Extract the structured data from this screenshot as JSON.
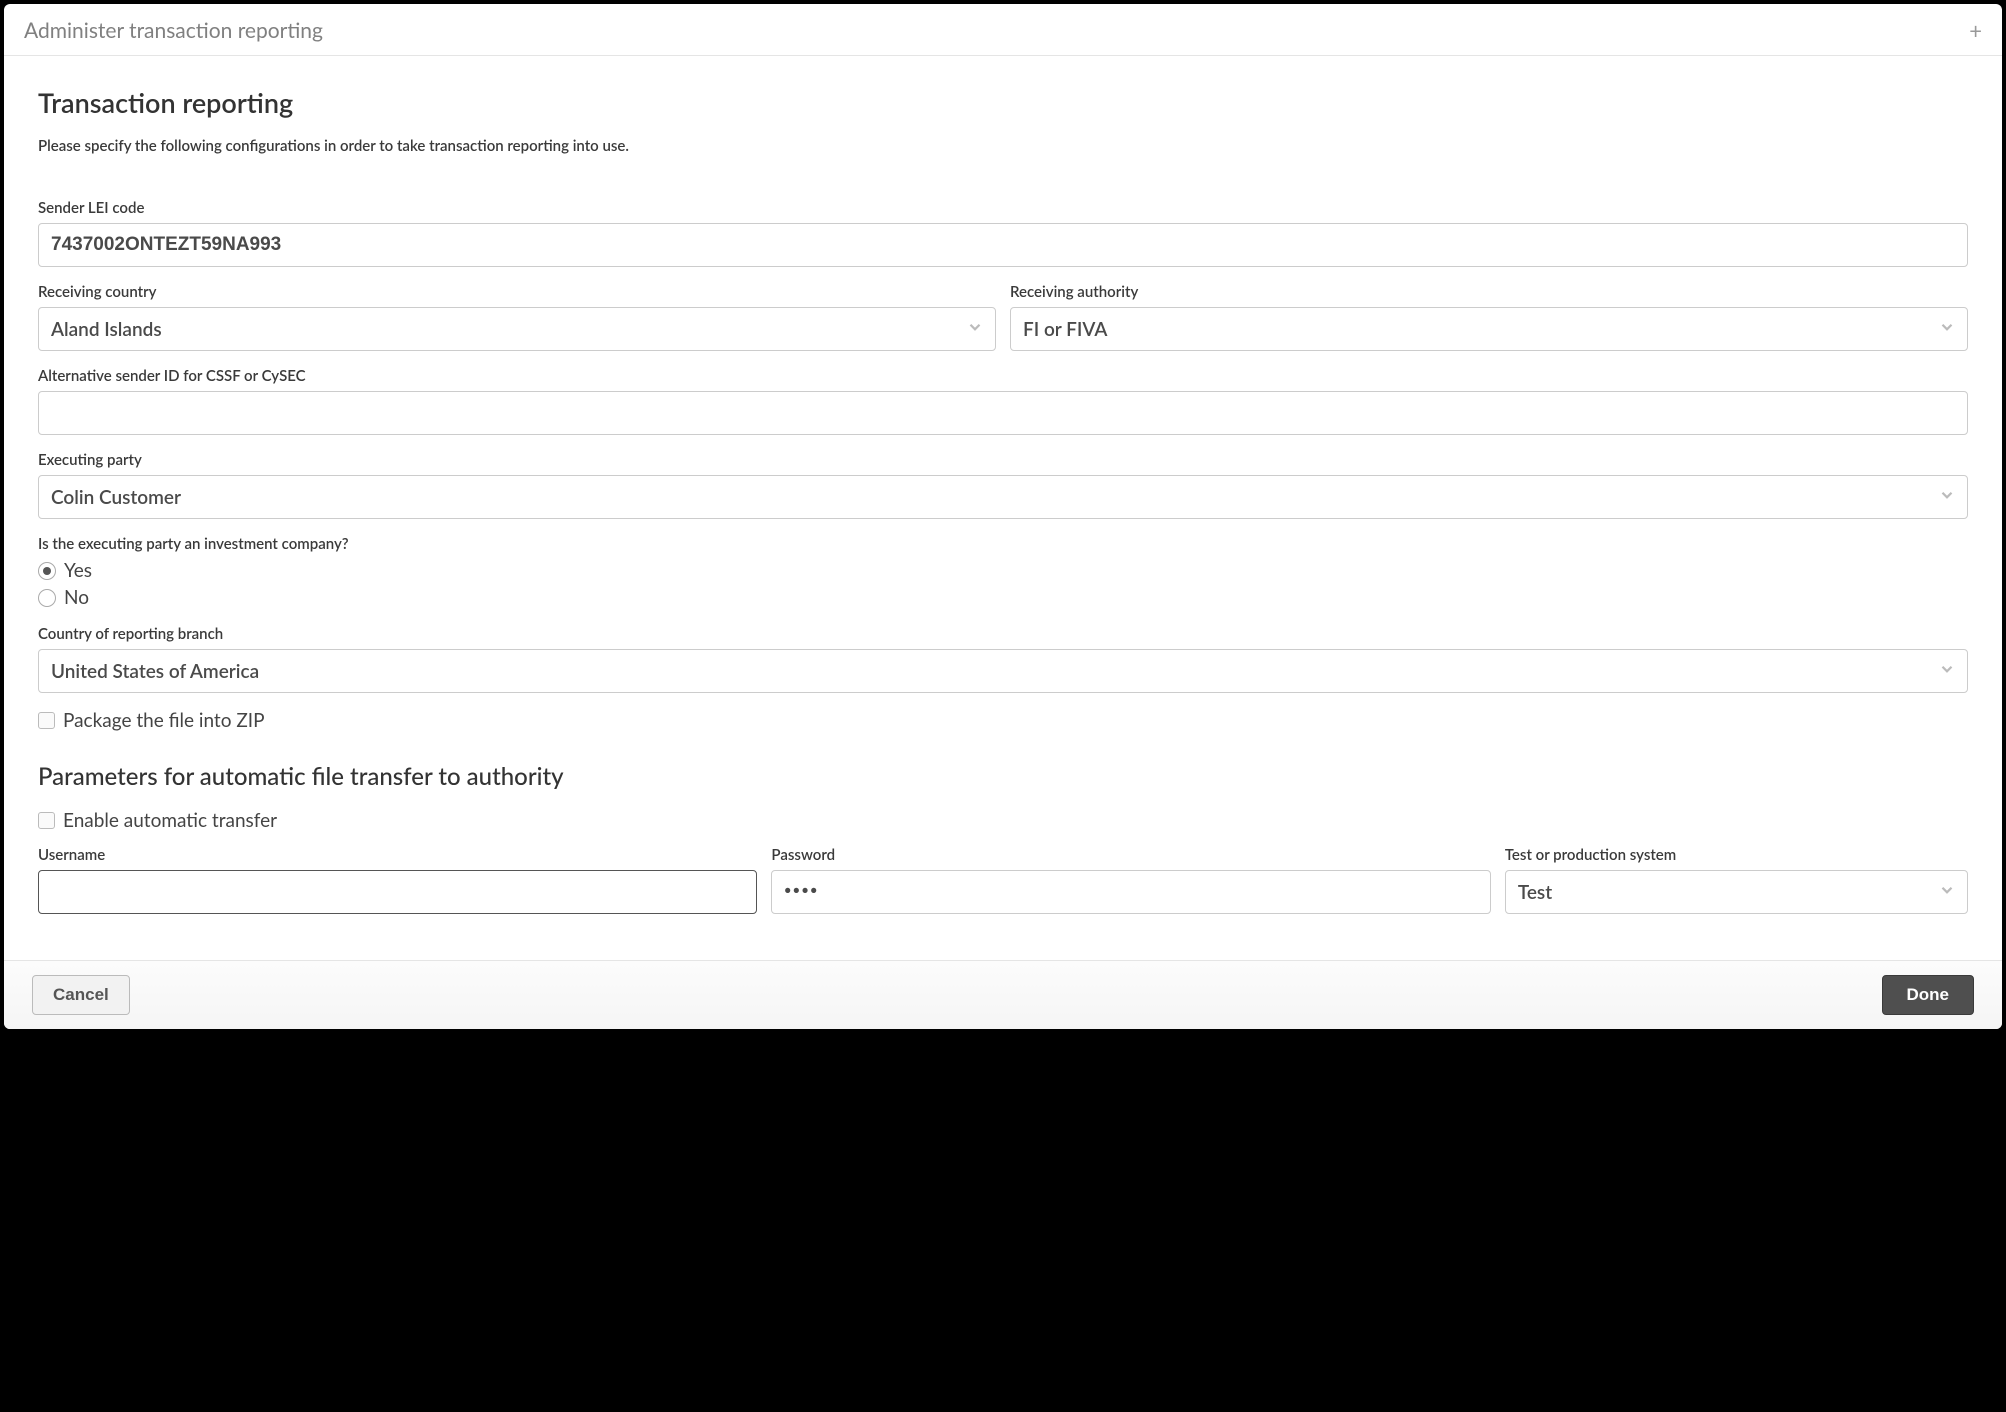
{
  "window": {
    "title": "Administer transaction reporting"
  },
  "page": {
    "heading": "Transaction reporting",
    "instruction": "Please specify the following configurations in order to take transaction reporting into use."
  },
  "fields": {
    "sender_lei": {
      "label": "Sender LEI code",
      "value": "7437002ONTEZT59NA993"
    },
    "receiving_country": {
      "label": "Receiving country",
      "value": "Aland Islands"
    },
    "receiving_authority": {
      "label": "Receiving authority",
      "value": "FI or FIVA"
    },
    "alt_sender_id": {
      "label": "Alternative sender ID for CSSF or CySEC",
      "value": ""
    },
    "executing_party": {
      "label": "Executing party",
      "value": "Colin Customer"
    },
    "investment_company": {
      "label": "Is the executing party an investment company?",
      "options": {
        "yes": "Yes",
        "no": "No"
      },
      "selected": "yes"
    },
    "reporting_branch": {
      "label": "Country of reporting branch",
      "value": "United States of America"
    },
    "package_zip": {
      "label": "Package the file into ZIP",
      "checked": false
    }
  },
  "transfer": {
    "heading": "Parameters for automatic file transfer to authority",
    "enable": {
      "label": "Enable automatic transfer",
      "checked": false
    },
    "username": {
      "label": "Username",
      "value": ""
    },
    "password": {
      "label": "Password",
      "value": "••••"
    },
    "system": {
      "label": "Test or production system",
      "value": "Test"
    }
  },
  "footer": {
    "cancel": "Cancel",
    "done": "Done"
  }
}
